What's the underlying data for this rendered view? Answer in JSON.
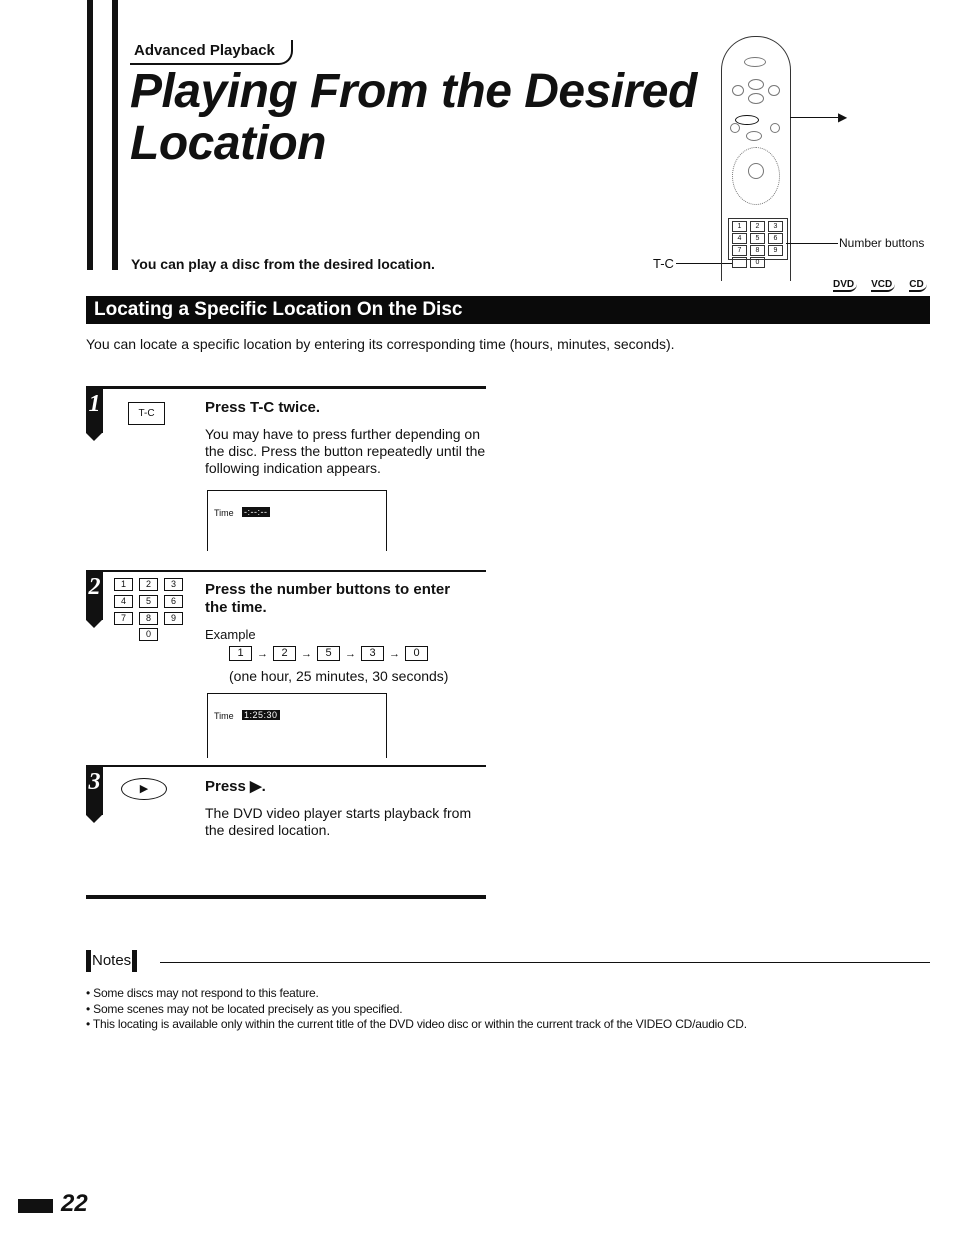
{
  "header": {
    "section_tag": "Advanced Playback",
    "title_line1": "Playing From the Desired",
    "title_line2": "Location",
    "subtitle": "You can play a disc from the desired location."
  },
  "remote_diagram": {
    "tc_label": "T-C",
    "play_label": "▶",
    "number_buttons_label": "Number buttons",
    "keys": [
      "1",
      "2",
      "3",
      "4",
      "5",
      "6",
      "7",
      "8",
      "9",
      "0"
    ]
  },
  "disc_types": [
    "DVD",
    "VCD",
    "CD"
  ],
  "section": {
    "heading": "Locating a Specific Location On the Disc",
    "intro": "You can locate a specific location by entering its corresponding time (hours, minutes, seconds)."
  },
  "steps": [
    {
      "number": "1",
      "key_label": "T-C",
      "title": "Press T-C twice.",
      "body": "You may have to press further depending on the disc. Press the button repeatedly until the following indication appears.",
      "osd": {
        "label": "Time",
        "value": "-:--:--"
      }
    },
    {
      "number": "2",
      "keypad": [
        "1",
        "2",
        "3",
        "4",
        "5",
        "6",
        "7",
        "8",
        "9",
        "0"
      ],
      "title_line1": "Press the number buttons to enter",
      "title_line2": "the time.",
      "example_label": "Example",
      "sequence": [
        "1",
        "2",
        "5",
        "3",
        "0"
      ],
      "sequence_arrow": "→",
      "sequence_note": "(one hour, 25 minutes, 30 seconds)",
      "osd": {
        "label": "Time",
        "value": "1:25:30"
      }
    },
    {
      "number": "3",
      "key_label": "▶",
      "title": "Press ▶.",
      "body": "The DVD video player starts playback from the desired location."
    }
  ],
  "notes": {
    "label": "Notes",
    "items": [
      "• Some discs may not respond to this feature.",
      "• Some scenes may not be located precisely as you specified.",
      "• This locating is available only within the current title of the DVD video disc or within the current track of the VIDEO CD/audio CD."
    ]
  },
  "page_number": "22"
}
